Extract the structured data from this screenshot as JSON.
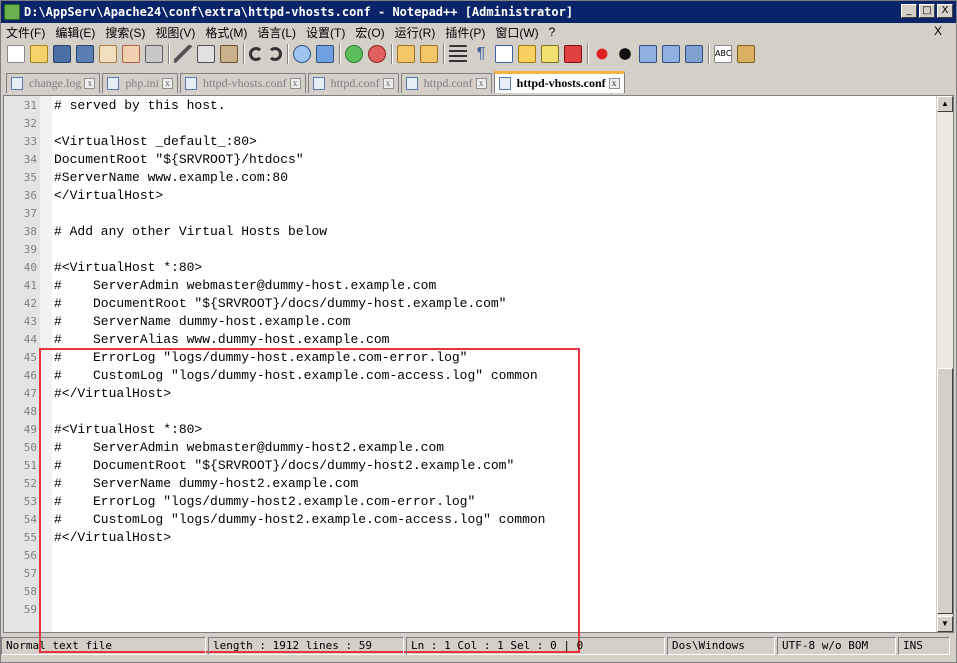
{
  "window": {
    "title": "D:\\AppServ\\Apache24\\conf\\extra\\httpd-vhosts.conf - Notepad++ [Administrator]",
    "controls": {
      "minimize": "_",
      "maximize": "□",
      "close": "X"
    }
  },
  "menubar": {
    "items": [
      "文件(F)",
      "编辑(E)",
      "搜索(S)",
      "视图(V)",
      "格式(M)",
      "语言(L)",
      "设置(T)",
      "宏(O)",
      "运行(R)",
      "插件(P)",
      "窗口(W)",
      "?"
    ],
    "close_label": "X"
  },
  "toolbar": {
    "icons": [
      "new-file-icon",
      "open-file-icon",
      "save-icon",
      "save-all-icon",
      "close-icon",
      "close-all-icon",
      "print-icon",
      "cut-icon",
      "copy-icon",
      "paste-icon",
      "undo-icon",
      "redo-icon",
      "find-icon",
      "replace-icon",
      "zoom-in-icon",
      "zoom-out-icon",
      "sync-vertical-icon",
      "sync-horizontal-icon",
      "word-wrap-icon",
      "show-all-chars-icon",
      "indent-guide-icon",
      "user-defined-language-icon",
      "function-list-icon",
      "folder-workspace-icon",
      "record-macro-icon",
      "stop-record-icon",
      "play-macro-icon",
      "run-macro-multiple-icon",
      "save-macro-icon",
      "spell-check-icon",
      "plugin-icon"
    ]
  },
  "tabs": [
    {
      "label": "change.log",
      "active": false
    },
    {
      "label": "php.ini",
      "active": false
    },
    {
      "label": "httpd-vhosts.conf",
      "active": false
    },
    {
      "label": "httpd.conf",
      "active": false
    },
    {
      "label": "httpd.conf",
      "active": false
    },
    {
      "label": "httpd-vhosts.conf",
      "active": true
    }
  ],
  "editor": {
    "lines": [
      {
        "n": "31",
        "text": "# served by this host."
      },
      {
        "n": "32",
        "text": ""
      },
      {
        "n": "33",
        "text": "<VirtualHost _default_:80>"
      },
      {
        "n": "34",
        "text": "DocumentRoot \"${SRVROOT}/htdocs\""
      },
      {
        "n": "35",
        "text": "#ServerName www.example.com:80"
      },
      {
        "n": "36",
        "text": "</VirtualHost>"
      },
      {
        "n": "37",
        "text": ""
      },
      {
        "n": "38",
        "text": "# Add any other Virtual Hosts below"
      },
      {
        "n": "39",
        "text": ""
      },
      {
        "n": "40",
        "text": "#<VirtualHost *:80>"
      },
      {
        "n": "41",
        "text": "#    ServerAdmin webmaster@dummy-host.example.com"
      },
      {
        "n": "42",
        "text": "#    DocumentRoot \"${SRVROOT}/docs/dummy-host.example.com\""
      },
      {
        "n": "43",
        "text": "#    ServerName dummy-host.example.com"
      },
      {
        "n": "44",
        "text": "#    ServerAlias www.dummy-host.example.com"
      },
      {
        "n": "45",
        "text": "#    ErrorLog \"logs/dummy-host.example.com-error.log\""
      },
      {
        "n": "46",
        "text": "#    CustomLog \"logs/dummy-host.example.com-access.log\" common"
      },
      {
        "n": "47",
        "text": "#</VirtualHost>"
      },
      {
        "n": "48",
        "text": ""
      },
      {
        "n": "49",
        "text": "#<VirtualHost *:80>"
      },
      {
        "n": "50",
        "text": "#    ServerAdmin webmaster@dummy-host2.example.com"
      },
      {
        "n": "51",
        "text": "#    DocumentRoot \"${SRVROOT}/docs/dummy-host2.example.com\""
      },
      {
        "n": "52",
        "text": "#    ServerName dummy-host2.example.com"
      },
      {
        "n": "53",
        "text": "#    ErrorLog \"logs/dummy-host2.example.com-error.log\""
      },
      {
        "n": "54",
        "text": "#    CustomLog \"logs/dummy-host2.example.com-access.log\" common"
      },
      {
        "n": "55",
        "text": "#</VirtualHost>"
      },
      {
        "n": "56",
        "text": ""
      },
      {
        "n": "57",
        "text": ""
      },
      {
        "n": "58",
        "text": ""
      },
      {
        "n": "59",
        "text": ""
      }
    ],
    "highlight_color": "#e8323c"
  },
  "statusbar": {
    "file_type": "Normal text file",
    "length_lines": "length : 1912    lines : 59",
    "position": "Ln : 1    Col : 1    Sel : 0 | 0",
    "eol": "Dos\\Windows",
    "encoding": "UTF-8 w/o BOM",
    "mode": "INS"
  },
  "colors": {
    "title_bg": "#0a246a",
    "active_tab_accent": "#fab541"
  }
}
